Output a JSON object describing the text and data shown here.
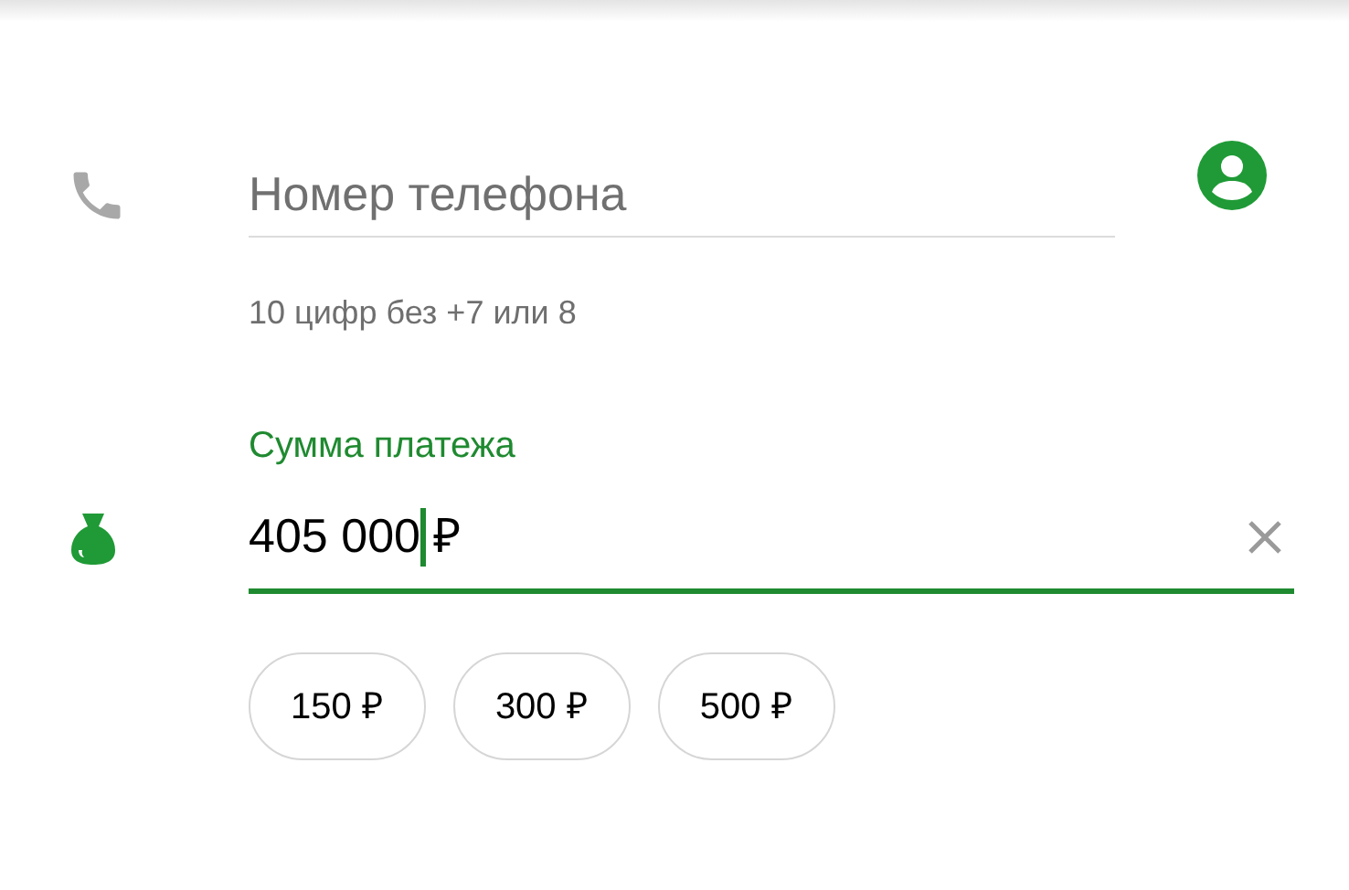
{
  "phone_field": {
    "placeholder": "Номер телефона",
    "hint": "10 цифр без +7 или 8"
  },
  "amount_field": {
    "label": "Сумма платежа",
    "value": "405 000",
    "currency": "₽",
    "focused": true
  },
  "quick_amounts": [
    {
      "label": "150 ₽"
    },
    {
      "label": "300 ₽"
    },
    {
      "label": "500 ₽"
    }
  ]
}
